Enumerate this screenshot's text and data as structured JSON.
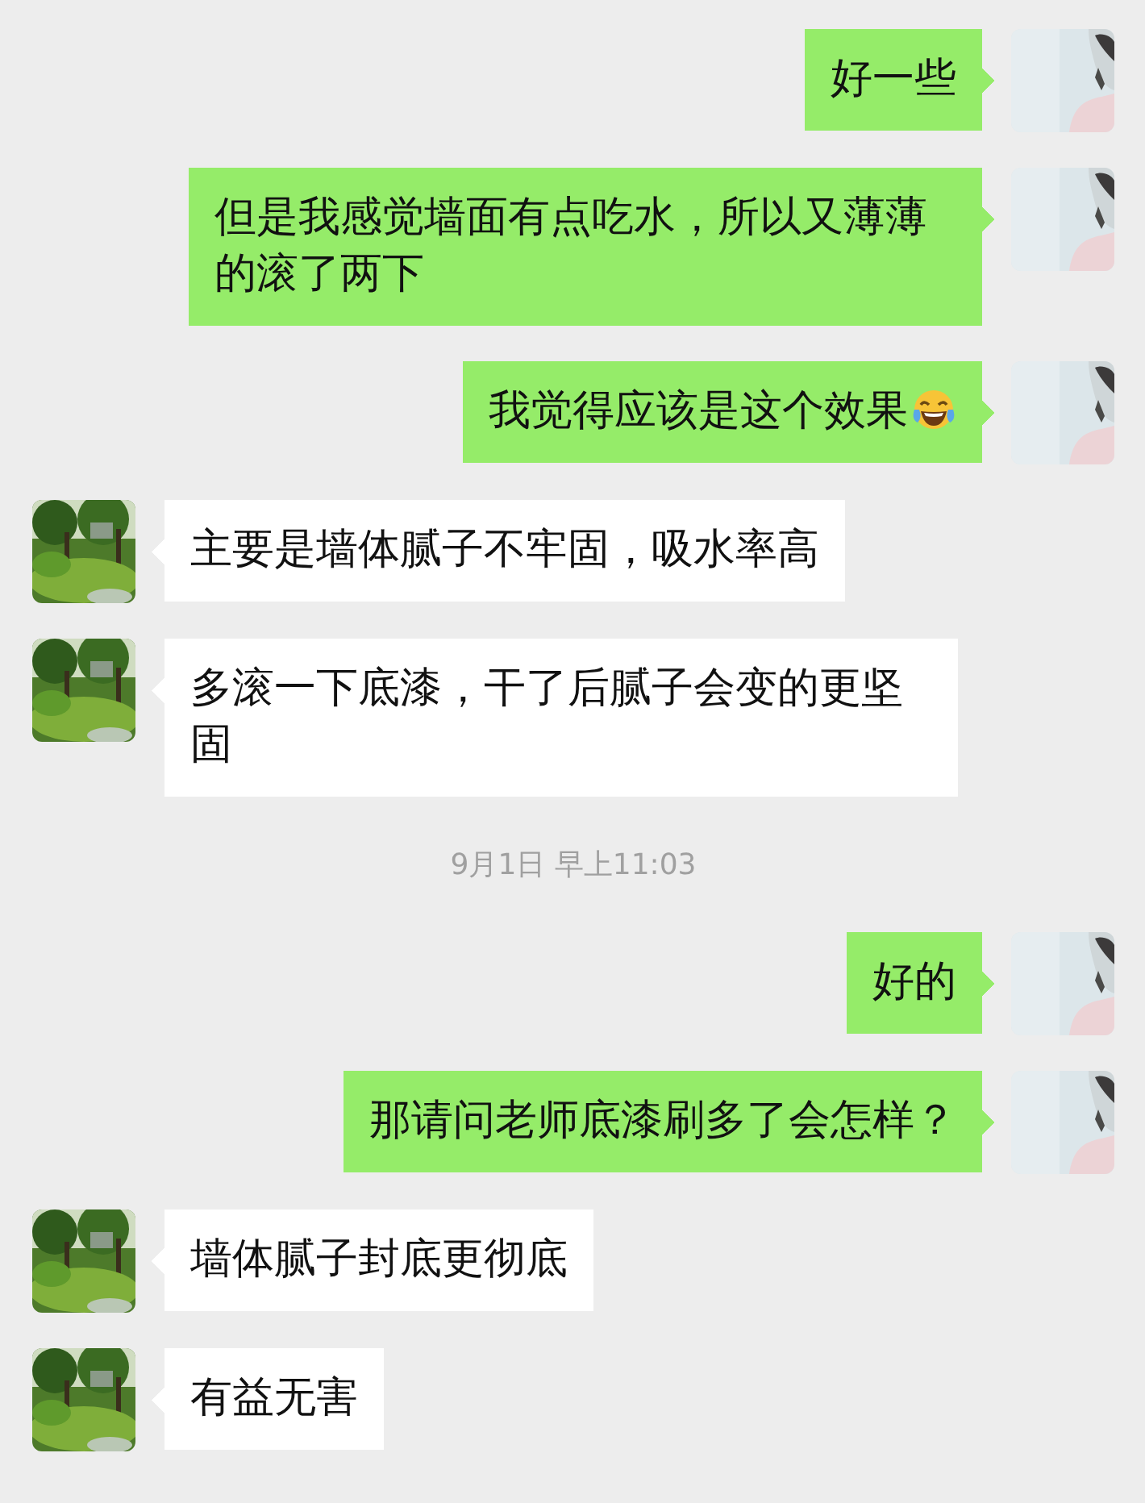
{
  "messages": [
    {
      "kind": "sent",
      "text": "好一些"
    },
    {
      "kind": "sent",
      "text": "但是我感觉墙面有点吃水，所以又薄薄的滚了两下"
    },
    {
      "kind": "sent",
      "text": "我觉得应该是这个效果",
      "emoji": true
    },
    {
      "kind": "received",
      "text": "主要是墙体腻子不牢固，吸水率高"
    },
    {
      "kind": "received",
      "text": "多滚一下底漆，干了后腻子会变的更坚固"
    },
    {
      "kind": "time",
      "text": "9月1日 早上11:03"
    },
    {
      "kind": "sent",
      "text": "好的"
    },
    {
      "kind": "sent",
      "text": "那请问老师底漆刷多了会怎样？"
    },
    {
      "kind": "received",
      "text": "墙体腻子封底更彻底"
    },
    {
      "kind": "received",
      "text": "有益无害"
    }
  ]
}
